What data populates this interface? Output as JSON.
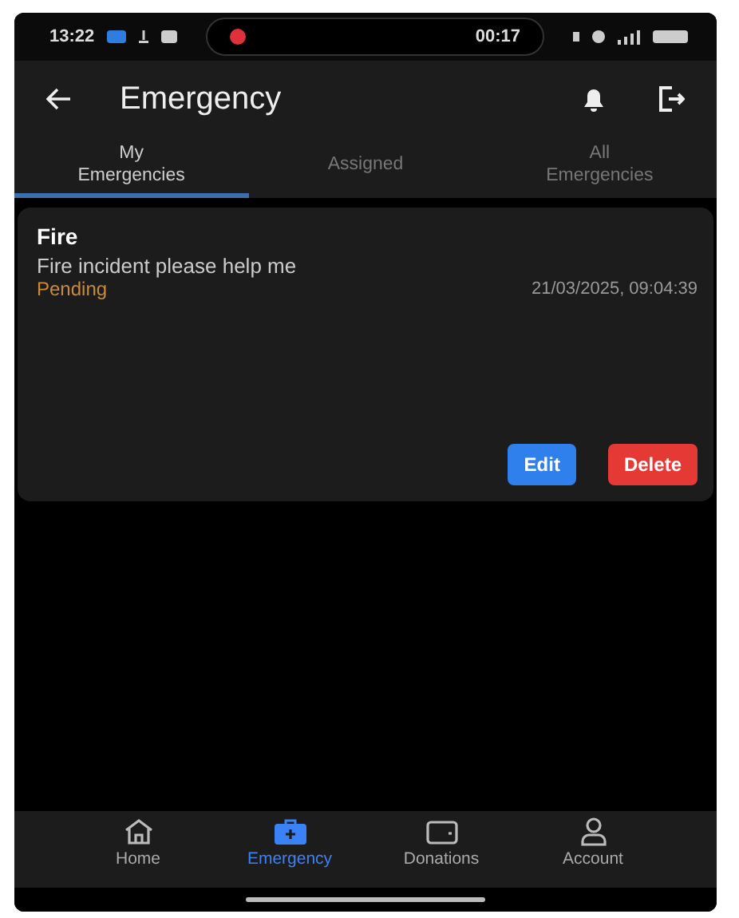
{
  "status_bar": {
    "time": "13:22",
    "recording_time": "00:17"
  },
  "header": {
    "title": "Emergency"
  },
  "tabs": [
    {
      "label": "My\nEmergencies",
      "selected": true
    },
    {
      "label": "Assigned",
      "selected": false
    },
    {
      "label": "All\nEmergencies",
      "selected": false
    }
  ],
  "emergencies": [
    {
      "title": "Fire",
      "description": "Fire incident please help me",
      "status": "Pending",
      "timestamp": "21/03/2025, 09:04:39",
      "actions": [
        "Edit",
        "Delete"
      ]
    }
  ],
  "bottom_nav": [
    {
      "label": "Home",
      "kind": "home",
      "selected": false
    },
    {
      "label": "Emergency",
      "kind": "emergency",
      "selected": true
    },
    {
      "label": "Donations",
      "kind": "wallet",
      "selected": false
    },
    {
      "label": "Account",
      "kind": "account",
      "selected": false
    }
  ]
}
